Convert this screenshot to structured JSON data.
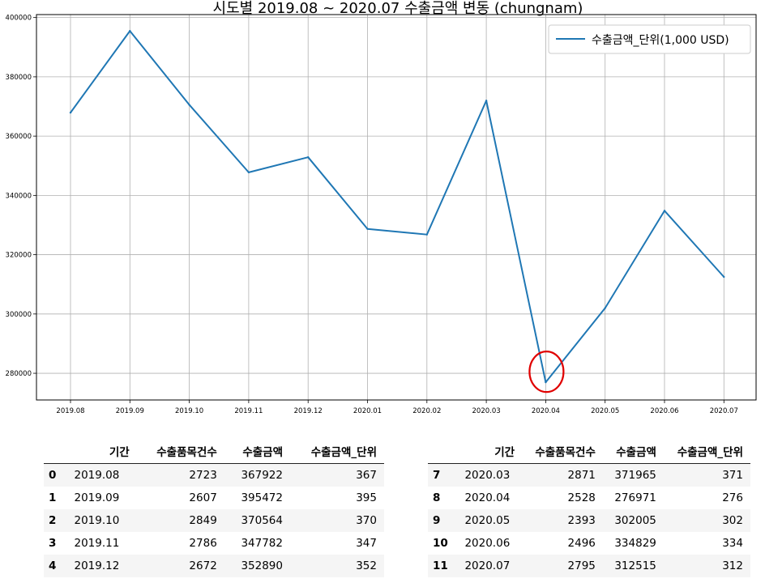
{
  "chart_data": {
    "type": "line",
    "title": "시도별 2019.08 ~ 2020.07 수출금액 변동 (chungnam)",
    "xlabel": "",
    "ylabel": "",
    "categories": [
      "2019.08",
      "2019.09",
      "2019.10",
      "2019.11",
      "2019.12",
      "2020.01",
      "2020.02",
      "2020.03",
      "2020.04",
      "2020.05",
      "2020.06",
      "2020.07"
    ],
    "series": [
      {
        "name": "수출금액_단위(1,000 USD)",
        "color": "#1f77b4",
        "values": [
          367922,
          395472,
          370564,
          347782,
          352890,
          328700,
          326800,
          371965,
          276971,
          302005,
          334829,
          312515
        ]
      }
    ],
    "ylim": [
      271000,
      401000
    ],
    "yticks": [
      "400000",
      "380000",
      "360000",
      "340000",
      "320000",
      "300000",
      "280000"
    ],
    "grid": true,
    "legend_position": "top-right",
    "highlight": {
      "category": "2020.04",
      "color": "#e00000"
    }
  },
  "tables": {
    "columns": [
      "",
      "기간",
      "수출품목건수",
      "수출금액",
      "수출금액_단위"
    ],
    "left_rows": [
      [
        "0",
        "2019.08",
        "2723",
        "367922",
        "367"
      ],
      [
        "1",
        "2019.09",
        "2607",
        "395472",
        "395"
      ],
      [
        "2",
        "2019.10",
        "2849",
        "370564",
        "370"
      ],
      [
        "3",
        "2019.11",
        "2786",
        "347782",
        "347"
      ],
      [
        "4",
        "2019.12",
        "2672",
        "352890",
        "352"
      ]
    ],
    "right_rows": [
      [
        "7",
        "2020.03",
        "2871",
        "371965",
        "371"
      ],
      [
        "8",
        "2020.04",
        "2528",
        "276971",
        "276"
      ],
      [
        "9",
        "2020.05",
        "2393",
        "302005",
        "302"
      ],
      [
        "10",
        "2020.06",
        "2496",
        "334829",
        "334"
      ],
      [
        "11",
        "2020.07",
        "2795",
        "312515",
        "312"
      ]
    ]
  }
}
